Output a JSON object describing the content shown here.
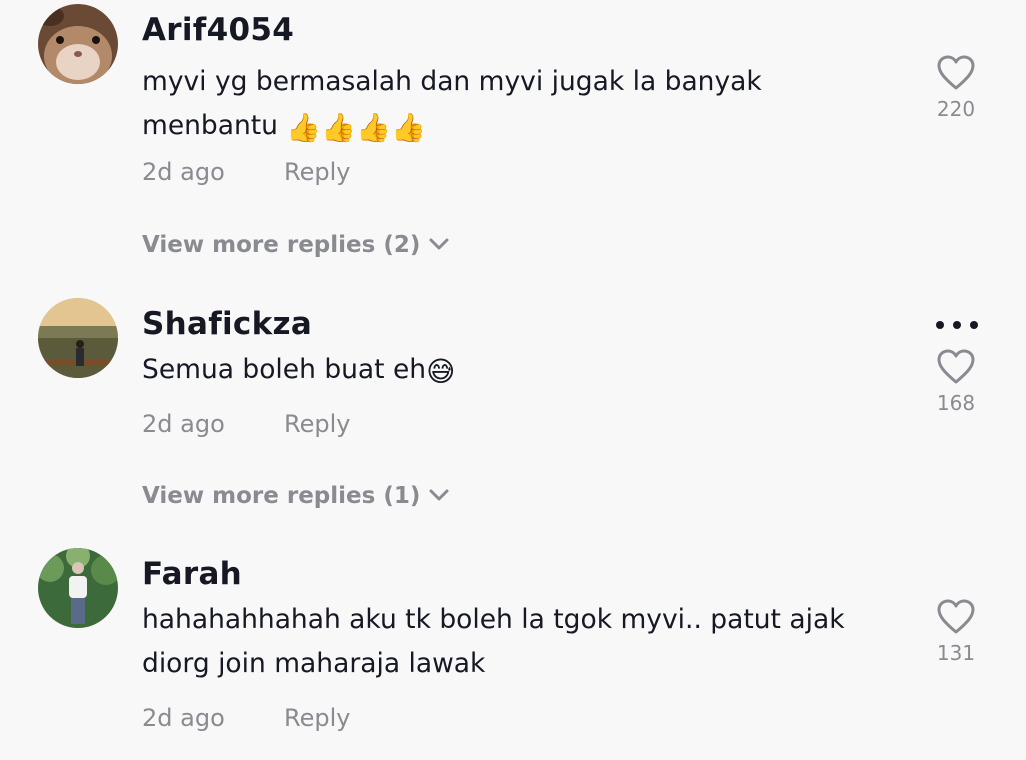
{
  "comments": [
    {
      "username": "Arif4054",
      "text": "myvi yg bermasalah dan myvi jugak la banyak menbantu",
      "emojis": "👍👍👍👍",
      "time": "2d ago",
      "reply_label": "Reply",
      "likes": "220",
      "more_replies": "View more replies (2)"
    },
    {
      "username": "Shafickza",
      "text": "Semua boleh buat eh",
      "emojis": "😅",
      "time": "2d ago",
      "reply_label": "Reply",
      "likes": "168",
      "more_replies": "View more replies (1)"
    },
    {
      "username": "Farah",
      "text": "hahahahhahah aku tk boleh la tgok myvi.. patut ajak diorg join maharaja lawak",
      "emojis": "",
      "time": "2d ago",
      "reply_label": "Reply",
      "likes": "131"
    }
  ],
  "icons": {
    "like": "heart-outline-icon",
    "expand": "chevron-down-icon",
    "options": "more-horizontal-icon"
  },
  "colors": {
    "background": "#f8f8f8",
    "primary_text": "#161823",
    "secondary_text": "#8a8b91"
  }
}
